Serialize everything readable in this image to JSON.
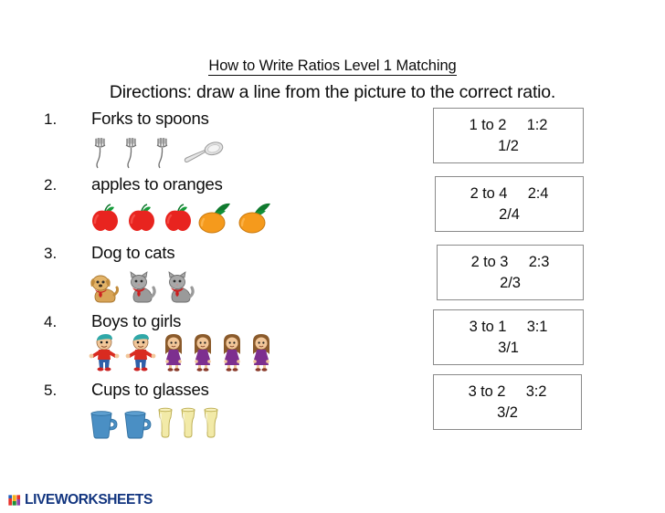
{
  "worksheet": {
    "title": "How to Write Ratios Level 1 Matching",
    "directions": "Directions: draw a line from the picture to the correct ratio."
  },
  "problems": [
    {
      "number": "1.",
      "label": "Forks to spoons",
      "left_icon": "fork-icon",
      "left_count": 3,
      "right_icon": "spoon-icon",
      "right_count": 1
    },
    {
      "number": "2.",
      "label": "apples to oranges",
      "left_icon": "apple-icon",
      "left_count": 3,
      "right_icon": "orange-icon",
      "right_count": 2
    },
    {
      "number": "3.",
      "label": "Dog to cats",
      "left_icon": "dog-icon",
      "left_count": 1,
      "right_icon": "cat-icon",
      "right_count": 2
    },
    {
      "number": "4.",
      "label": "Boys to girls",
      "left_icon": "boy-icon",
      "left_count": 2,
      "right_icon": "girl-icon",
      "right_count": 4
    },
    {
      "number": "5.",
      "label": "Cups to glasses",
      "left_icon": "cup-icon",
      "left_count": 2,
      "right_icon": "glass-icon",
      "right_count": 3
    }
  ],
  "answers": [
    {
      "words": "1 to 2",
      "colon": "1:2",
      "fraction": "1/2"
    },
    {
      "words": "2 to 4",
      "colon": "2:4",
      "fraction": "2/4"
    },
    {
      "words": "2 to 3",
      "colon": "2:3",
      "fraction": "2/3"
    },
    {
      "words": "3 to 1",
      "colon": "3:1",
      "fraction": "3/1"
    },
    {
      "words": "3 to 2",
      "colon": "3:2",
      "fraction": "3/2"
    }
  ],
  "footer": {
    "brand": "LIVEWORKSHEETS",
    "brand_color": "#12357f",
    "mark_colors": [
      "#e8312a",
      "#f3b01c",
      "#1a8f3c",
      "#1f5fbf",
      "#8e44ad",
      "#e8312a"
    ]
  },
  "colors": {
    "box_border": "#8a8a8a",
    "text": "#0d0d0d",
    "apple": "#e8241f",
    "orange": "#f59a1c",
    "leaf": "#0f7a2e",
    "cup": "#4a8fc4",
    "glass": "#f2eaa8",
    "boy_shirt": "#d92b20",
    "boy_pants": "#2f5fa8",
    "girl_dress": "#7d2f8f",
    "hair": "#8a5a2b",
    "cat": "#9a9a9a",
    "dog": "#d8a457",
    "bow": "#cc1f1f",
    "fork": "#7a7a7a",
    "spoon": "#cfcfcf"
  }
}
